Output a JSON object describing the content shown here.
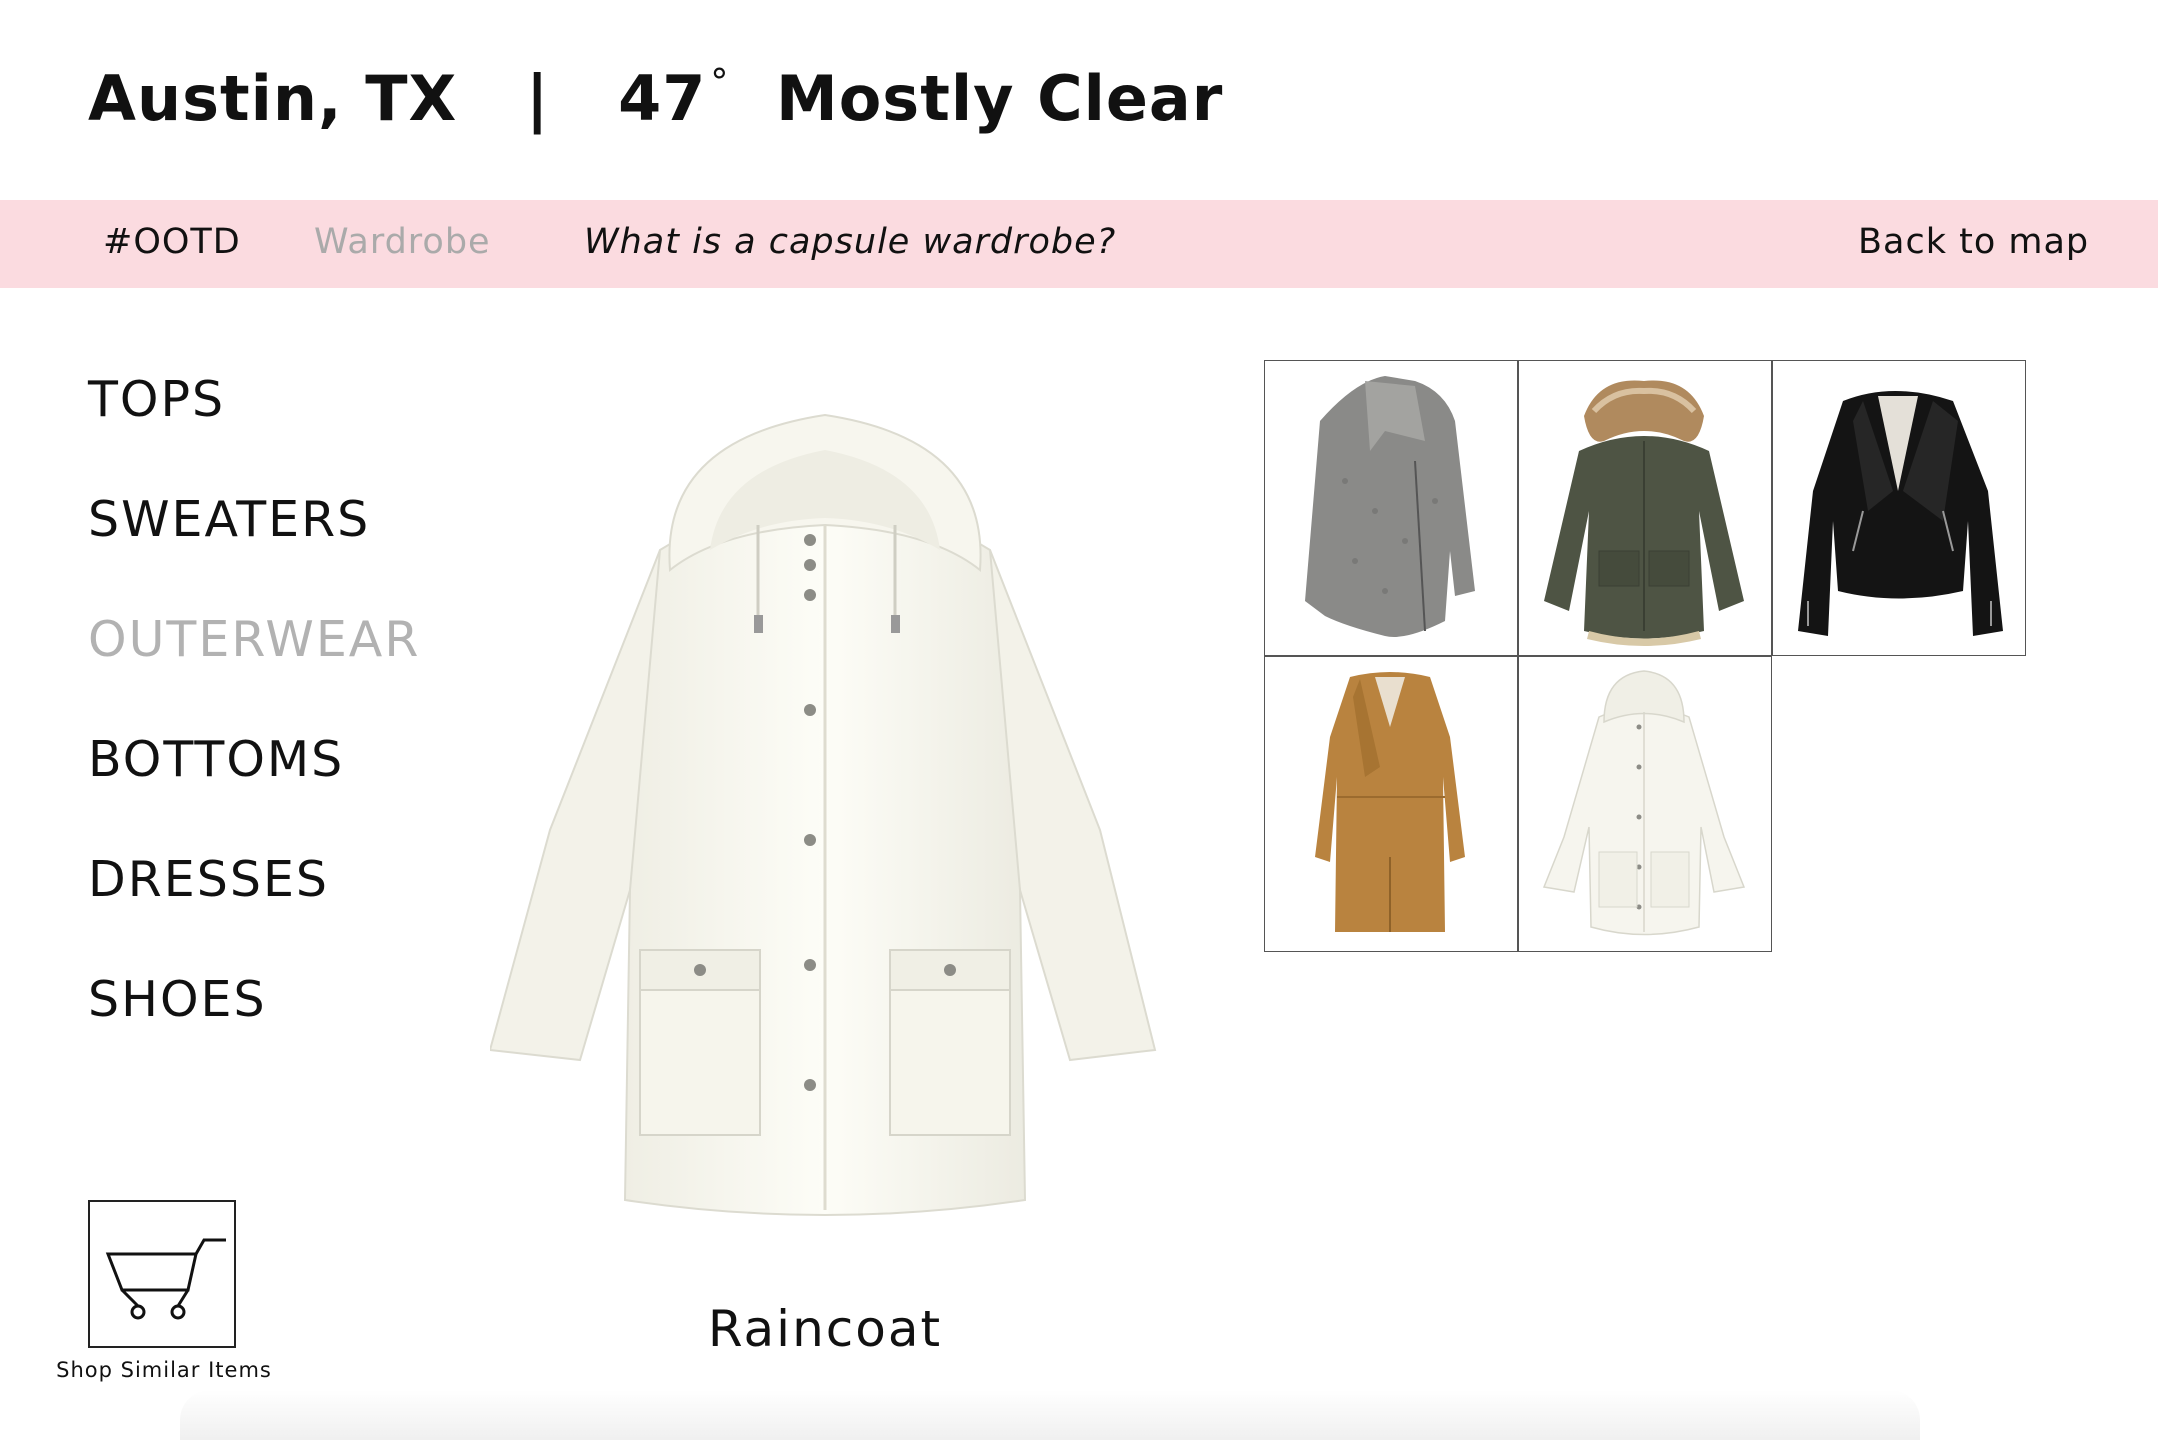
{
  "header": {
    "city": "Austin, TX",
    "separator": "|",
    "temperature": "47",
    "degree_symbol": "°",
    "condition": "Mostly Clear"
  },
  "nav": {
    "ootd": "#OOTD",
    "wardrobe": "Wardrobe",
    "capsule": "What is a capsule wardrobe?",
    "back": "Back to map"
  },
  "categories": [
    "TOPS",
    "SWEATERS",
    "OUTERWEAR",
    "BOTTOMS",
    "DRESSES",
    "SHOES"
  ],
  "selected_category": "OUTERWEAR",
  "item": {
    "name": "Raincoat"
  },
  "shop": {
    "label": "Shop Similar Items"
  },
  "wardrobe_grid": [
    {
      "item": "gray-wool-coat"
    },
    {
      "item": "green-parka-fur-hood"
    },
    {
      "item": "black-leather-jacket"
    },
    {
      "item": "camel-long-coat"
    },
    {
      "item": "white-raincoat"
    }
  ],
  "colors": {
    "nav_background": "#fbdbe0",
    "muted_text": "#aaaaaa",
    "text": "#111111"
  }
}
